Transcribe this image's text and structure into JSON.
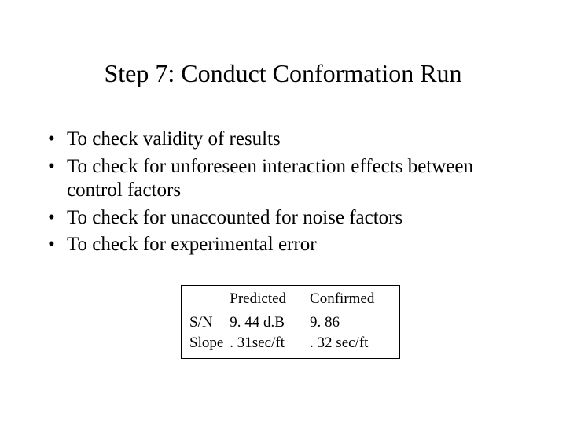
{
  "title": "Step 7: Conduct Conformation Run",
  "bullets": [
    "To check validity of results",
    "To check for unforeseen interaction effects between control factors",
    "To check for unaccounted for noise factors",
    "To check for experimental error"
  ],
  "table": {
    "headers": [
      "Predicted",
      "Confirmed"
    ],
    "rows": [
      {
        "label": "S/N",
        "predicted": "9. 44 d.B",
        "confirmed": "9. 86"
      },
      {
        "label": "Slope",
        "predicted": ". 31sec/ft",
        "confirmed": ". 32 sec/ft"
      }
    ]
  }
}
